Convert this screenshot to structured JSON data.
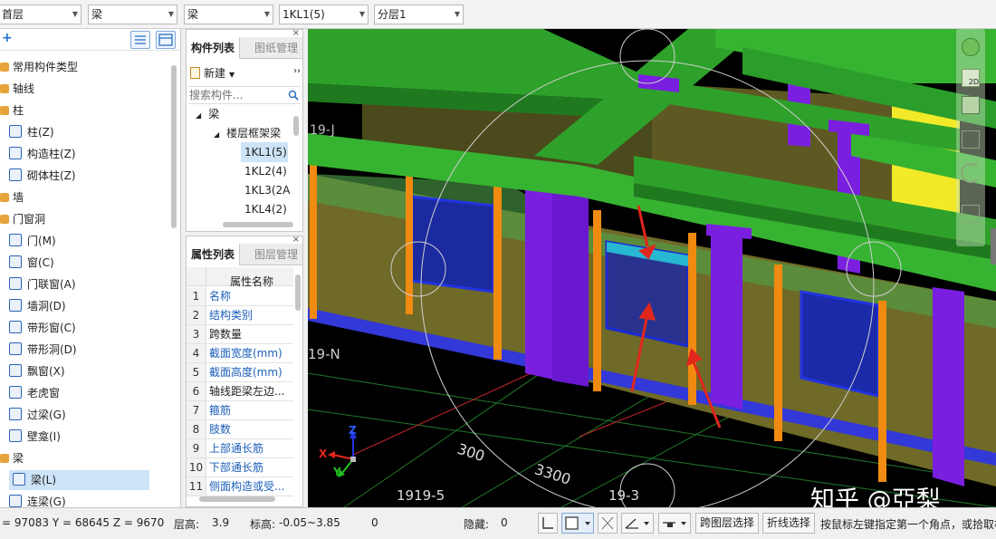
{
  "toolbar": {
    "floor": "首层",
    "type1": "梁",
    "type2": "梁",
    "component": "1KL1(5)",
    "layer": "分层1"
  },
  "left_tree": {
    "add_symbol": "+",
    "items": [
      {
        "label": "常用构件类型",
        "icon": "category-icon"
      },
      {
        "label": "轴线",
        "icon": "category-icon"
      },
      {
        "label": "柱",
        "icon": "category-icon"
      },
      {
        "label": "柱(Z)",
        "icon": "column-icon"
      },
      {
        "label": "构造柱(Z)",
        "icon": "construct-column-icon"
      },
      {
        "label": "砌体柱(Z)",
        "icon": "masonry-column-icon"
      },
      {
        "label": "墙",
        "icon": "category-icon"
      },
      {
        "label": "门窗洞",
        "icon": "category-icon"
      },
      {
        "label": "门(M)",
        "icon": "door-icon"
      },
      {
        "label": "窗(C)",
        "icon": "window-icon"
      },
      {
        "label": "门联窗(A)",
        "icon": "door-window-icon"
      },
      {
        "label": "墙洞(D)",
        "icon": "wall-hole-icon"
      },
      {
        "label": "带形窗(C)",
        "icon": "strip-window-icon"
      },
      {
        "label": "带形洞(D)",
        "icon": "strip-hole-icon"
      },
      {
        "label": "飘窗(X)",
        "icon": "bay-window-icon"
      },
      {
        "label": "老虎窗",
        "icon": "dormer-icon"
      },
      {
        "label": "过梁(G)",
        "icon": "lintel-icon"
      },
      {
        "label": "壁龛(I)",
        "icon": "niche-icon"
      },
      {
        "label": "梁",
        "icon": "category-icon"
      },
      {
        "label": "梁(L)",
        "icon": "beam-icon"
      },
      {
        "label": "连梁(G)",
        "icon": "coupling-beam-icon"
      }
    ]
  },
  "component_panel": {
    "tab_active": "构件列表",
    "tab_inactive": "图纸管理",
    "new_label": "新建",
    "search_placeholder": "搜索构件...",
    "tree_root": "梁",
    "tree_group": "楼层框架梁",
    "items": [
      "1KL1(5)",
      "1KL2(4)",
      "1KL3(2A",
      "1KL4(2)"
    ]
  },
  "property_panel": {
    "tab_active": "属性列表",
    "tab_inactive": "图层管理",
    "header": "属性名称",
    "rows": [
      {
        "n": "1",
        "name": "名称",
        "blue": true
      },
      {
        "n": "2",
        "name": "结构类别",
        "blue": true
      },
      {
        "n": "3",
        "name": "跨数量",
        "blue": false
      },
      {
        "n": "4",
        "name": "截面宽度(mm)",
        "blue": true
      },
      {
        "n": "5",
        "name": "截面高度(mm)",
        "blue": true
      },
      {
        "n": "6",
        "name": "轴线距梁左边...",
        "blue": false
      },
      {
        "n": "7",
        "name": "箍筋",
        "blue": true
      },
      {
        "n": "8",
        "name": "肢数",
        "blue": true
      },
      {
        "n": "9",
        "name": "上部通长筋",
        "blue": true
      },
      {
        "n": "10",
        "name": "下部通长筋",
        "blue": true
      },
      {
        "n": "11",
        "name": "侧面构造或受...",
        "blue": true
      }
    ]
  },
  "viewport": {
    "labels": {
      "axis_n": "19-N",
      "axis_j": "19-J",
      "dim_300": "300",
      "dim_3300": "3300",
      "axis_5": "1919-5",
      "axis_3": "19-3",
      "x": "X",
      "y": "Y",
      "z": "Z"
    },
    "watermark": "知乎 @亞梨"
  },
  "statusbar": {
    "coords": "= 97083 Y = 68645 Z = 9670",
    "floor_height_label": "层高:",
    "floor_height": "3.9",
    "elevation_label": "标高:",
    "elevation": "-0.05~3.85",
    "count": "0",
    "hidden_label": "隐藏:",
    "hidden_count": "0",
    "cross_layer_btn": "跨图层选择",
    "polyline_btn": "折线选择",
    "hint": "按鼠标左键指定第一个角点，或拾取构"
  }
}
